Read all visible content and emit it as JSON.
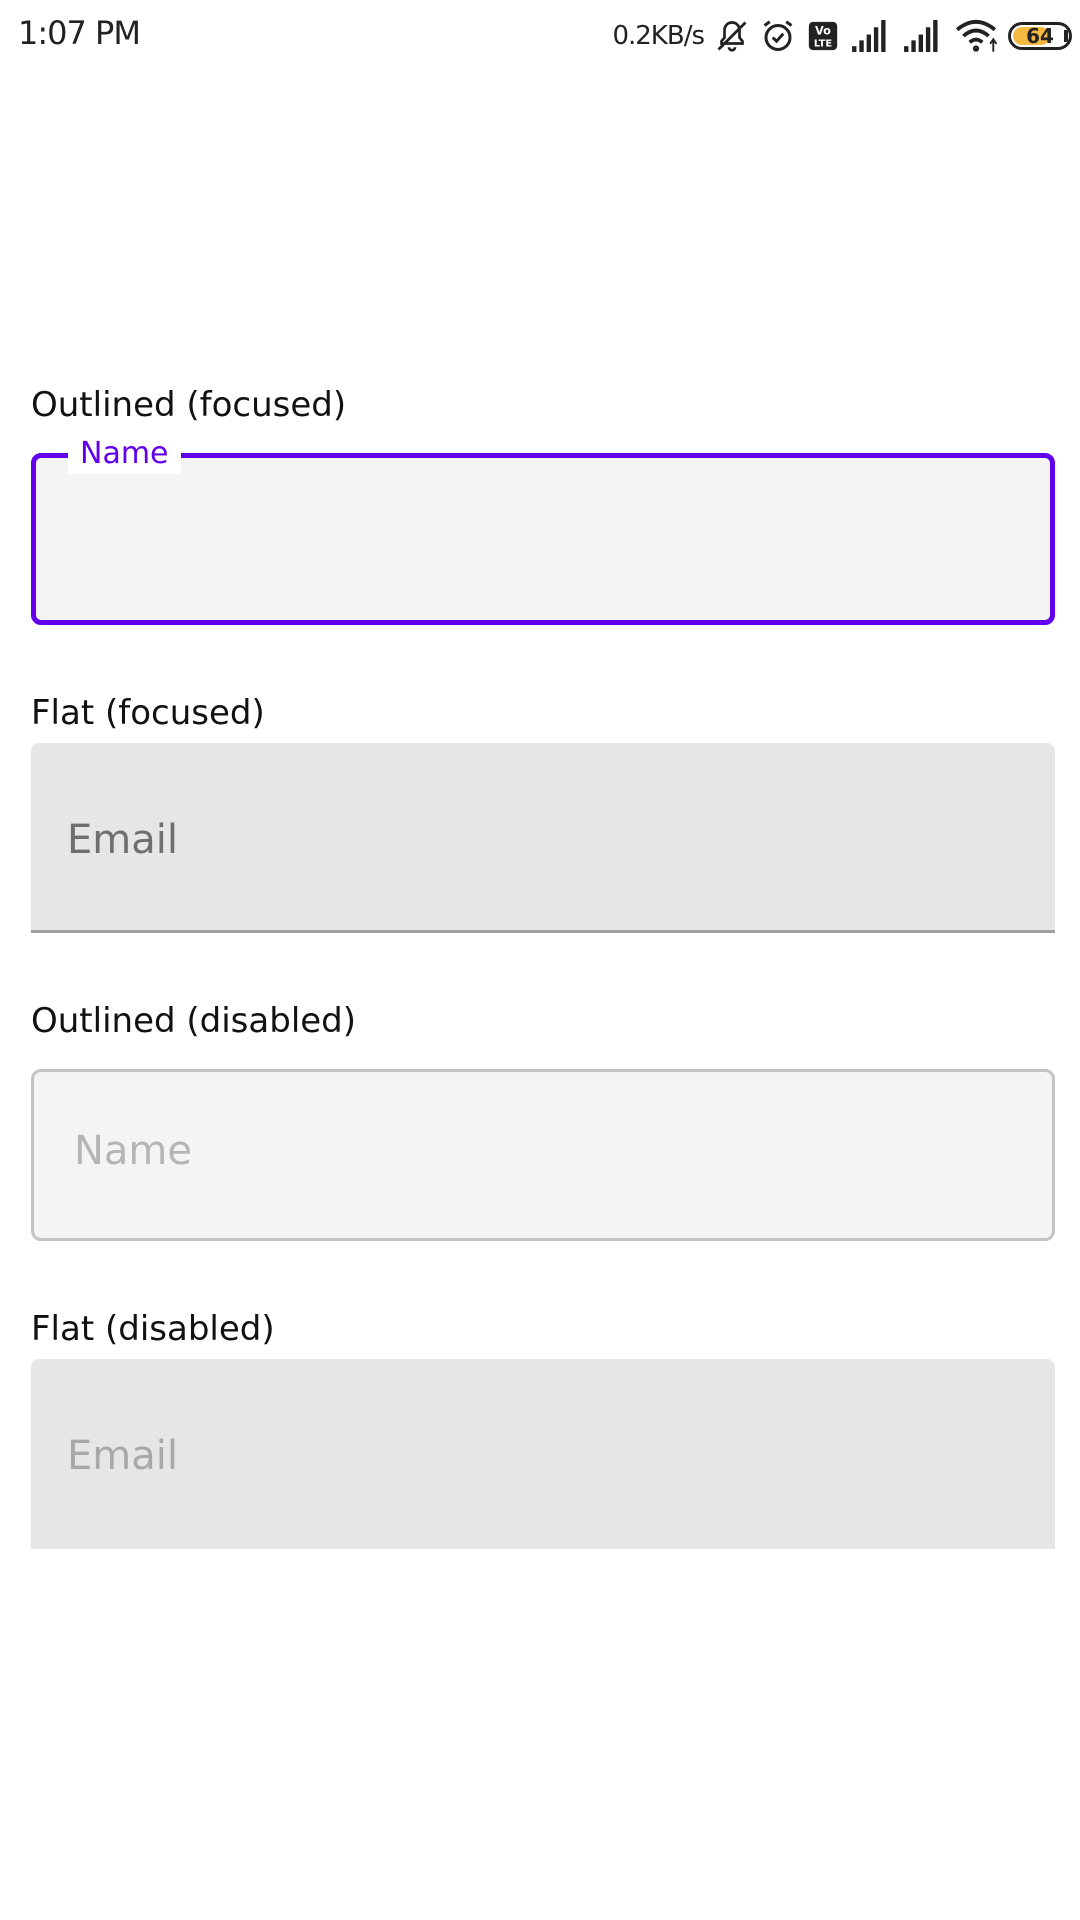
{
  "status_bar": {
    "time": "1:07 PM",
    "net_speed": "0.2KB/s",
    "battery_level": "64",
    "battery_fill_fraction": 0.64,
    "battery_color": "#f5b942",
    "icons": [
      "notifications-muted-icon",
      "alarm-icon",
      "volte-icon",
      "signal-icon",
      "signal-icon",
      "wifi-icon",
      "battery-icon"
    ]
  },
  "form": {
    "outlined_focused": {
      "section_label": "Outlined (focused)",
      "floating_label": "Name",
      "value": "",
      "accent_color": "#6200ee"
    },
    "flat_focused": {
      "section_label": "Flat (focused)",
      "placeholder": "Email",
      "value": ""
    },
    "outlined_disabled": {
      "section_label": "Outlined (disabled)",
      "placeholder": "Name",
      "value": ""
    },
    "flat_disabled": {
      "section_label": "Flat (disabled)",
      "placeholder": "Email",
      "value": ""
    }
  }
}
